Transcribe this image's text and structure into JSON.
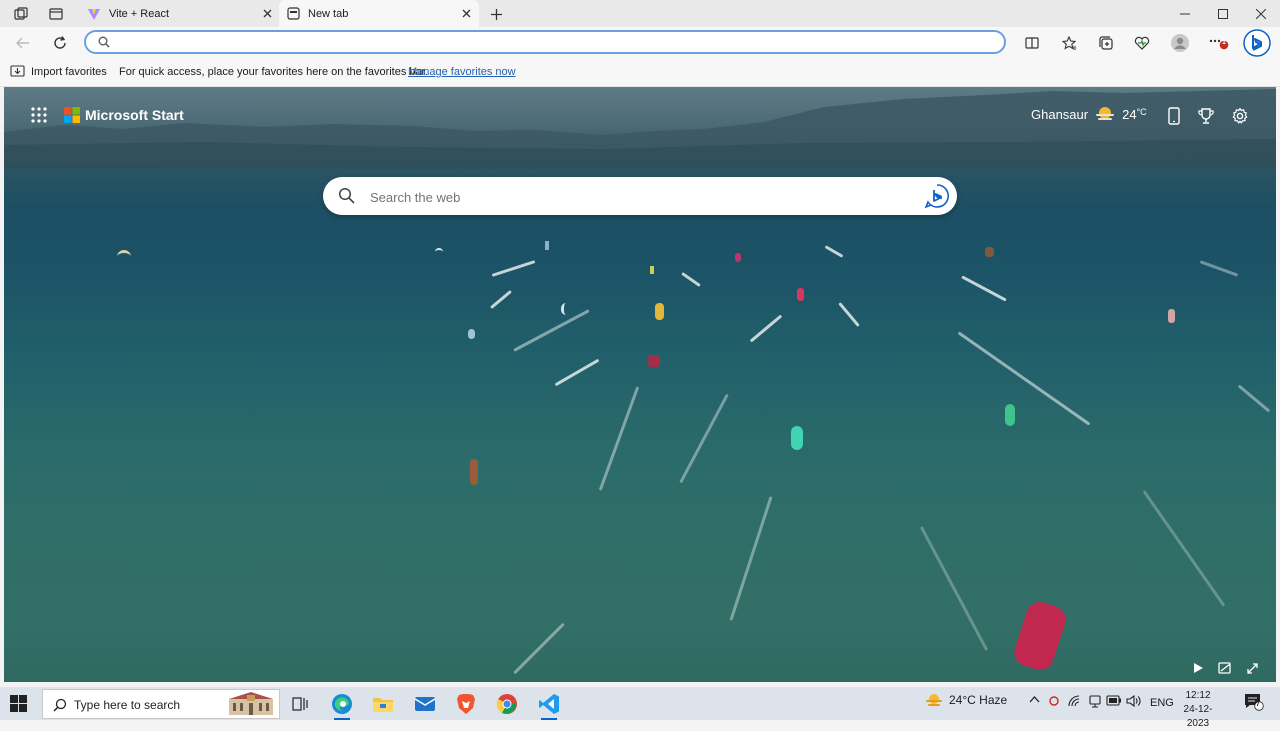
{
  "browser": {
    "tabs": [
      {
        "title": "Vite + React",
        "icon": "vite-icon"
      },
      {
        "title": "New tab",
        "icon": "newtab-icon"
      }
    ],
    "address": {
      "value": "",
      "placeholder": ""
    },
    "favorites_bar": {
      "import_label": "Import favorites",
      "message": "For quick access, place your favorites here on the favorites bar.",
      "link": "Manage favorites now"
    },
    "notification_badge": "1"
  },
  "start_page": {
    "brand": "Microsoft Start",
    "location": "Ghansaur",
    "temperature": "24",
    "temperature_unit": "°C",
    "search_placeholder": "Search the web"
  },
  "taskbar": {
    "search_placeholder": "Type here to search",
    "weather": "24°C  Haze",
    "language": "ENG",
    "time": "12:12",
    "date": "24-12-2023",
    "notifications": "7"
  },
  "colors": {
    "accent": "#0b63c7",
    "link": "#2661b3"
  }
}
